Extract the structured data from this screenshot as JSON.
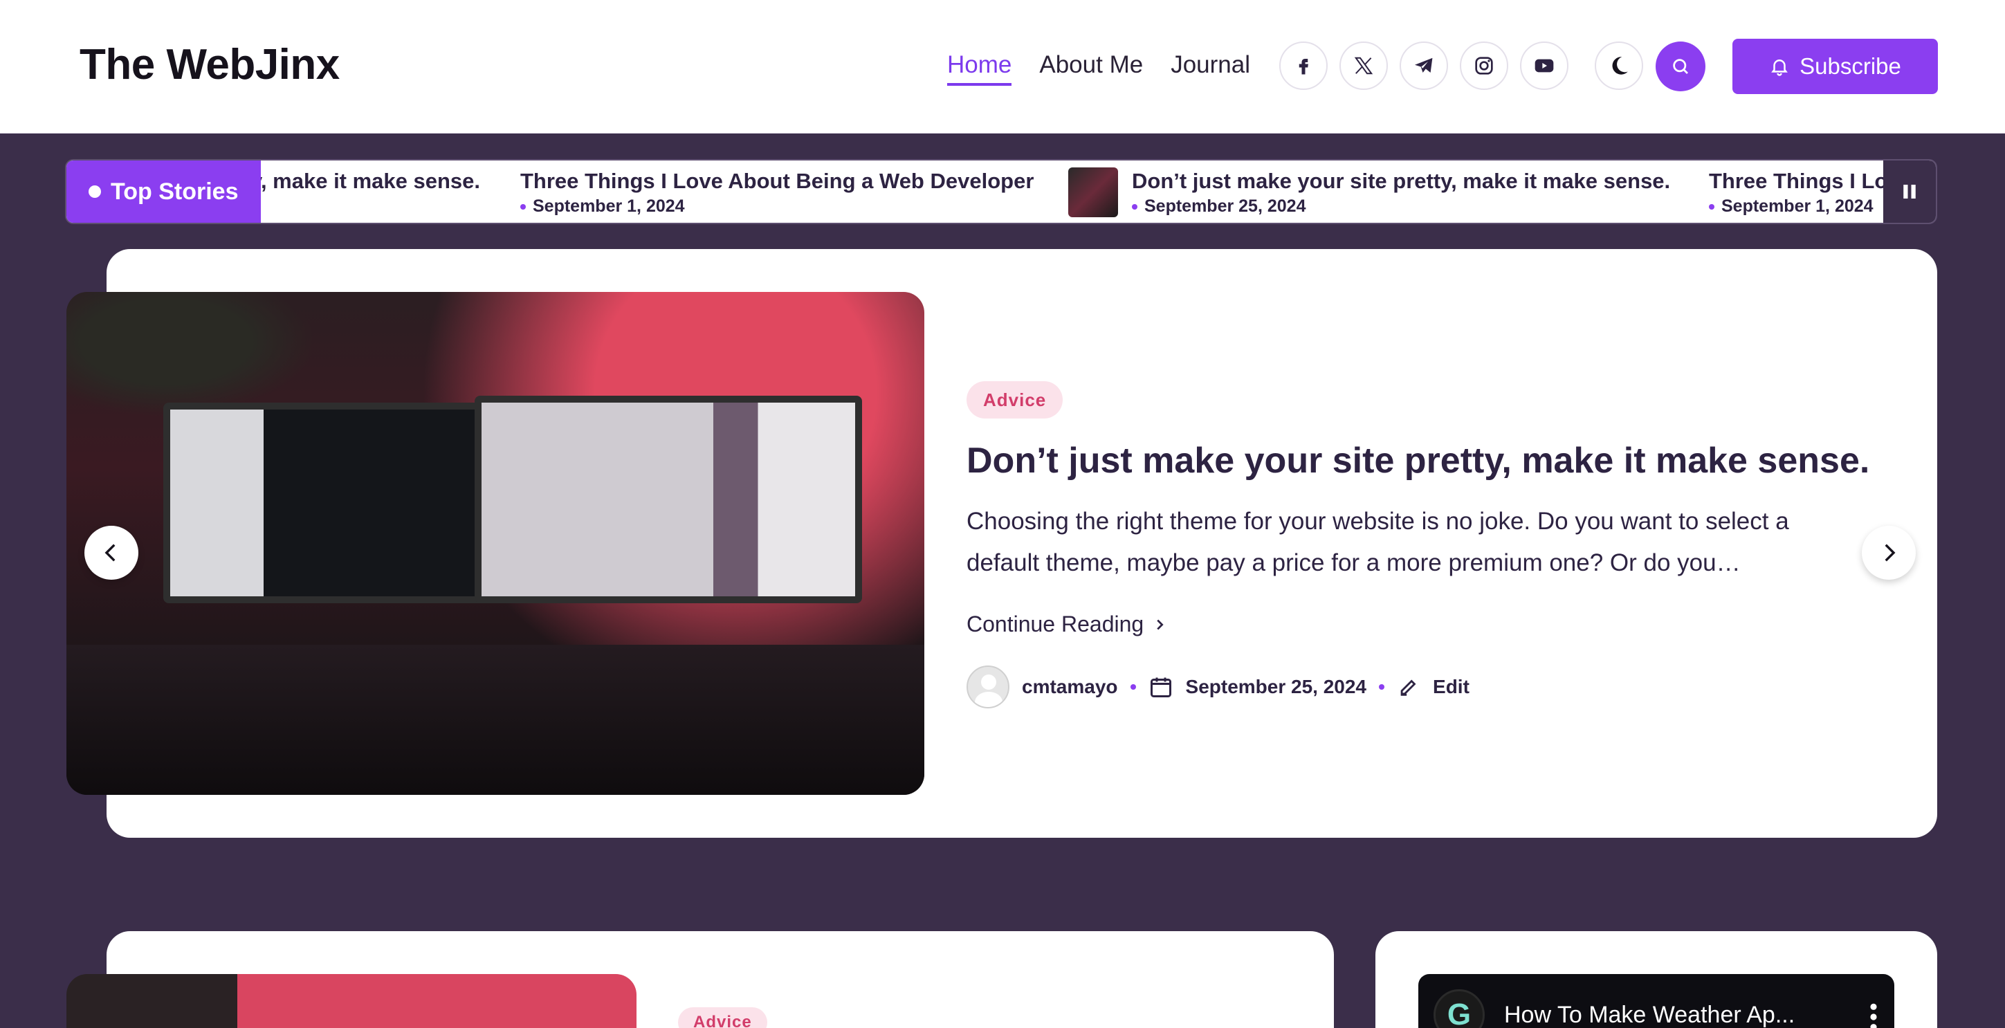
{
  "site": {
    "title": "The WebJinx"
  },
  "nav": {
    "items": [
      {
        "label": "Home",
        "active": true
      },
      {
        "label": "About Me",
        "active": false
      },
      {
        "label": "Journal",
        "active": false
      }
    ]
  },
  "social": [
    "facebook-icon",
    "x-icon",
    "telegram-icon",
    "instagram-icon",
    "youtube-icon"
  ],
  "header": {
    "subscribe_label": "Subscribe"
  },
  "ticker": {
    "label": "Top Stories",
    "items": [
      {
        "title": "y, make it make sense.",
        "date": ""
      },
      {
        "title": "Three Things I Love About Being a Web Developer",
        "date": "September 1, 2024"
      },
      {
        "title": "Don’t just make your site pretty, make it make sense.",
        "date": "September 25, 2024"
      },
      {
        "title": "Three Things I Lo",
        "date": "September 1, 2024"
      }
    ]
  },
  "featured": {
    "category": "Advice",
    "title": "Don’t just make your site pretty, make it make sense.",
    "excerpt": "Choosing the right theme for your website is no joke. Do you want to select a default theme, maybe pay a price for a more premium one? Or do you…",
    "continue_label": "Continue Reading",
    "author": "cmtamayo",
    "date": "September 25, 2024",
    "edit_label": "Edit"
  },
  "second_post": {
    "category": "Advice"
  },
  "video": {
    "title": "How To Make Weather Ap..."
  },
  "colors": {
    "accent": "#8b3ef0",
    "background": "#3b2e4a",
    "badge_text": "#d23d6a",
    "badge_bg": "#fbe2ea"
  }
}
